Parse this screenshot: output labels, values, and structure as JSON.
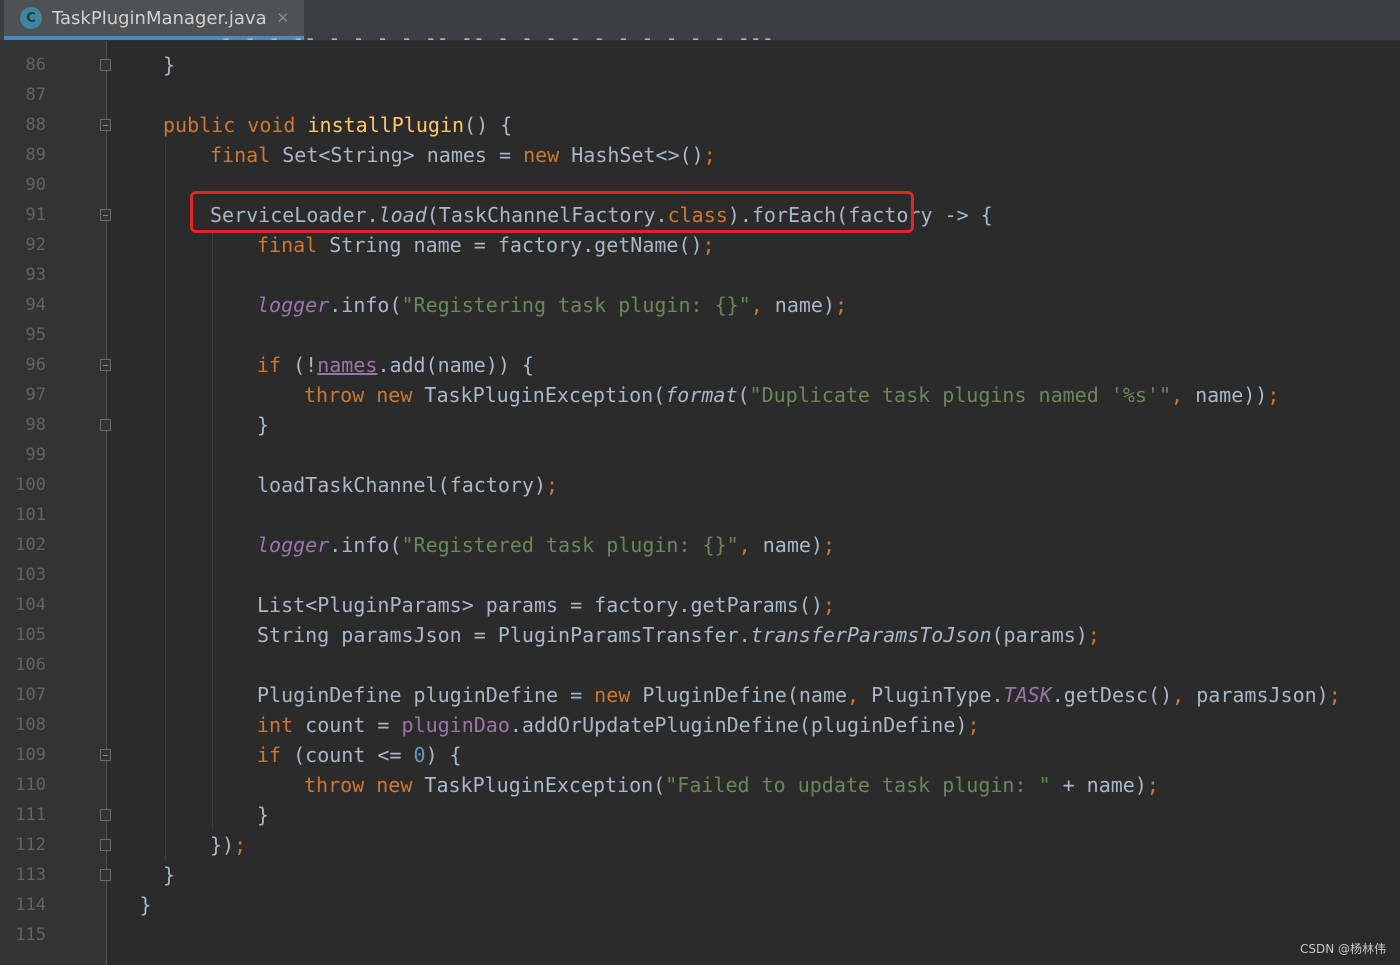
{
  "tab": {
    "icon_letter": "C",
    "file_name": "TaskPluginManager.java",
    "close_glyph": "✕"
  },
  "partial_top_line": "- - - -- - - - - -- -- - - - - - - - - - - ---,",
  "lines": [
    {
      "n": "86",
      "indent": 1,
      "fold": "end",
      "segs": [
        [
          "p",
          "}"
        ]
      ]
    },
    {
      "n": "87",
      "indent": 0,
      "fold": "",
      "segs": []
    },
    {
      "n": "88",
      "indent": 1,
      "fold": "open",
      "segs": [
        [
          "kw",
          "public void "
        ],
        [
          "fn",
          "installPlugin"
        ],
        [
          "p",
          "() {"
        ]
      ]
    },
    {
      "n": "89",
      "indent": 2,
      "fold": "",
      "segs": [
        [
          "kw",
          "final "
        ],
        [
          "p",
          "Set<String> names = "
        ],
        [
          "kw",
          "new "
        ],
        [
          "p",
          "HashSet<>()"
        ],
        [
          "semi",
          ";"
        ]
      ]
    },
    {
      "n": "90",
      "indent": 0,
      "fold": "",
      "segs": []
    },
    {
      "n": "91",
      "indent": 2,
      "fold": "open",
      "segs": [
        [
          "p",
          "ServiceLoader."
        ],
        [
          "it",
          "load"
        ],
        [
          "p",
          "(TaskChannelFactory."
        ],
        [
          "kw",
          "class"
        ],
        [
          "p",
          ").forEach(factory -> {"
        ]
      ]
    },
    {
      "n": "92",
      "indent": 3,
      "fold": "",
      "segs": [
        [
          "kw",
          "final "
        ],
        [
          "p",
          "String name = factory.getName()"
        ],
        [
          "semi",
          ";"
        ]
      ]
    },
    {
      "n": "93",
      "indent": 0,
      "fold": "",
      "segs": []
    },
    {
      "n": "94",
      "indent": 3,
      "fold": "",
      "segs": [
        [
          "fld-it",
          "logger"
        ],
        [
          "p",
          ".info("
        ],
        [
          "str",
          "\"Registering task plugin: {}\""
        ],
        [
          "semi",
          ", "
        ],
        [
          "p",
          "name)"
        ],
        [
          "semi",
          ";"
        ]
      ]
    },
    {
      "n": "95",
      "indent": 0,
      "fold": "",
      "segs": []
    },
    {
      "n": "96",
      "indent": 3,
      "fold": "open",
      "segs": [
        [
          "kw",
          "if "
        ],
        [
          "p",
          "(!"
        ],
        [
          "fld-ul",
          "names"
        ],
        [
          "p",
          ".add(name)) {"
        ]
      ]
    },
    {
      "n": "97",
      "indent": 4,
      "fold": "",
      "segs": [
        [
          "kw",
          "throw new "
        ],
        [
          "p",
          "TaskPluginException("
        ],
        [
          "it",
          "format"
        ],
        [
          "p",
          "("
        ],
        [
          "str",
          "\"Duplicate task plugins named '%s'\""
        ],
        [
          "semi",
          ", "
        ],
        [
          "p",
          "name))"
        ],
        [
          "semi",
          ";"
        ]
      ]
    },
    {
      "n": "98",
      "indent": 3,
      "fold": "end",
      "segs": [
        [
          "p",
          "}"
        ]
      ]
    },
    {
      "n": "99",
      "indent": 0,
      "fold": "",
      "segs": []
    },
    {
      "n": "100",
      "indent": 3,
      "fold": "",
      "segs": [
        [
          "p",
          "loadTaskChannel(factory)"
        ],
        [
          "semi",
          ";"
        ]
      ]
    },
    {
      "n": "101",
      "indent": 0,
      "fold": "",
      "segs": []
    },
    {
      "n": "102",
      "indent": 3,
      "fold": "",
      "segs": [
        [
          "fld-it",
          "logger"
        ],
        [
          "p",
          ".info("
        ],
        [
          "str",
          "\"Registered task plugin: {}\""
        ],
        [
          "semi",
          ", "
        ],
        [
          "p",
          "name)"
        ],
        [
          "semi",
          ";"
        ]
      ]
    },
    {
      "n": "103",
      "indent": 0,
      "fold": "",
      "segs": []
    },
    {
      "n": "104",
      "indent": 3,
      "fold": "",
      "segs": [
        [
          "p",
          "List<PluginParams> params = factory.getParams()"
        ],
        [
          "semi",
          ";"
        ]
      ]
    },
    {
      "n": "105",
      "indent": 3,
      "fold": "",
      "segs": [
        [
          "p",
          "String paramsJson = PluginParamsTransfer."
        ],
        [
          "it",
          "transferParamsToJson"
        ],
        [
          "p",
          "(params)"
        ],
        [
          "semi",
          ";"
        ]
      ]
    },
    {
      "n": "106",
      "indent": 0,
      "fold": "",
      "segs": []
    },
    {
      "n": "107",
      "indent": 3,
      "fold": "",
      "segs": [
        [
          "p",
          "PluginDefine pluginDefine = "
        ],
        [
          "kw",
          "new "
        ],
        [
          "p",
          "PluginDefine(name"
        ],
        [
          "semi",
          ", "
        ],
        [
          "p",
          "PluginType."
        ],
        [
          "fld-it",
          "TASK"
        ],
        [
          "p",
          ".getDesc()"
        ],
        [
          "semi",
          ", "
        ],
        [
          "p",
          "paramsJson)"
        ],
        [
          "semi",
          ";"
        ]
      ]
    },
    {
      "n": "108",
      "indent": 3,
      "fold": "",
      "segs": [
        [
          "kw",
          "int "
        ],
        [
          "p",
          "count = "
        ],
        [
          "fld",
          "pluginDao"
        ],
        [
          "p",
          ".addOrUpdatePluginDefine(pluginDefine)"
        ],
        [
          "semi",
          ";"
        ]
      ]
    },
    {
      "n": "109",
      "indent": 3,
      "fold": "open",
      "segs": [
        [
          "kw",
          "if "
        ],
        [
          "p",
          "(count <= "
        ],
        [
          "num",
          "0"
        ],
        [
          "p",
          ") {"
        ]
      ]
    },
    {
      "n": "110",
      "indent": 4,
      "fold": "",
      "segs": [
        [
          "kw",
          "throw new "
        ],
        [
          "p",
          "TaskPluginException("
        ],
        [
          "str",
          "\"Failed to update task plugin: \""
        ],
        [
          "p",
          " + name)"
        ],
        [
          "semi",
          ";"
        ]
      ]
    },
    {
      "n": "111",
      "indent": 3,
      "fold": "end",
      "segs": [
        [
          "p",
          "}"
        ]
      ]
    },
    {
      "n": "112",
      "indent": 2,
      "fold": "end",
      "segs": [
        [
          "p",
          "})"
        ],
        [
          "semi",
          ";"
        ]
      ]
    },
    {
      "n": "113",
      "indent": 1,
      "fold": "end",
      "segs": [
        [
          "p",
          "}"
        ]
      ]
    },
    {
      "n": "114",
      "indent": 0.5,
      "fold": "",
      "segs": [
        [
          "p",
          "}"
        ]
      ]
    },
    {
      "n": "115",
      "indent": 0,
      "fold": "",
      "segs": []
    }
  ],
  "highlight_line": "91",
  "watermark": "CSDN @杨林伟"
}
